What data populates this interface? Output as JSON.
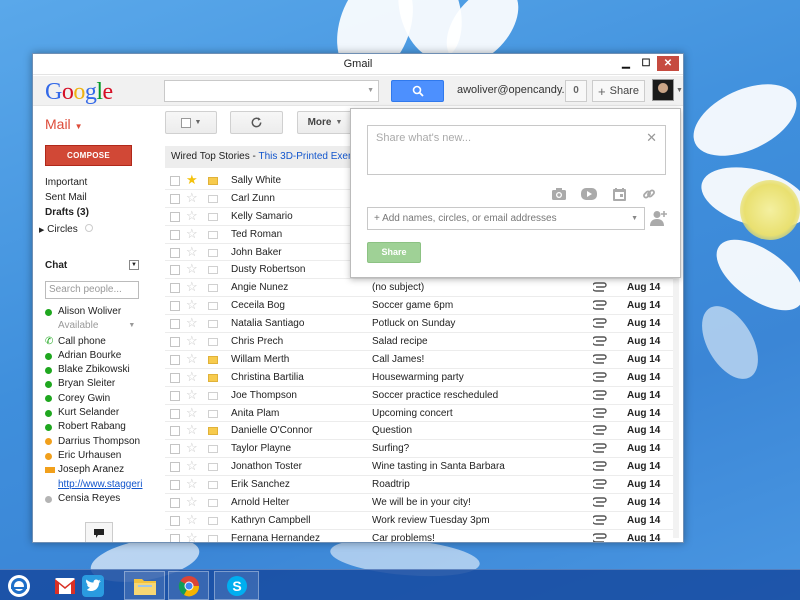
{
  "window": {
    "title": "Gmail"
  },
  "header": {
    "logo_letters": [
      {
        "ch": "G",
        "color": "#3369e8"
      },
      {
        "ch": "o",
        "color": "#d50f25"
      },
      {
        "ch": "o",
        "color": "#eeb211"
      },
      {
        "ch": "g",
        "color": "#3369e8"
      },
      {
        "ch": "l",
        "color": "#009925"
      },
      {
        "ch": "e",
        "color": "#d50f25"
      }
    ],
    "user_email": "awoliver@opencandy....",
    "notification_count": "0",
    "share_label": "Share"
  },
  "mail_label": "Mail",
  "toolbar": {
    "more_label": "More"
  },
  "compose_label": "COMPOSE",
  "nav": {
    "items": [
      {
        "label": "Important"
      },
      {
        "label": "Sent Mail"
      },
      {
        "label": "Drafts (3)"
      }
    ],
    "circles_label": "Circles"
  },
  "chat": {
    "title": "Chat",
    "search_placeholder": "Search people...",
    "self_name": "Alison Woliver",
    "self_status": "Available",
    "call_phone": "Call phone",
    "contacts": [
      {
        "name": "Adrian Bourke",
        "status": "green"
      },
      {
        "name": "Blake Zbikowski",
        "status": "green"
      },
      {
        "name": "Bryan Sleiter",
        "status": "green"
      },
      {
        "name": "Corey Gwin",
        "status": "green"
      },
      {
        "name": "Kurt Selander",
        "status": "green"
      },
      {
        "name": "Robert Rabang",
        "status": "green"
      },
      {
        "name": "Darrius Thompson",
        "status": "orange"
      },
      {
        "name": "Eric Urhausen",
        "status": "orange"
      }
    ],
    "video_contact": "Joseph Aranez",
    "video_link": "http://www.staggeri",
    "last_contact": "Censia Reyes"
  },
  "top_stories": {
    "source": "Wired Top Stories",
    "separator": " - ",
    "headline": "This 3D-Printed Exem"
  },
  "messages": [
    {
      "sender": "Sally White",
      "subject": "",
      "date": "",
      "starred": true,
      "label": true,
      "clip": false
    },
    {
      "sender": "Carl Zunn",
      "subject": "",
      "date": "",
      "starred": false,
      "label": false,
      "clip": false
    },
    {
      "sender": "Kelly Samario",
      "subject": "",
      "date": "",
      "starred": false,
      "label": false,
      "clip": false
    },
    {
      "sender": "Ted Roman",
      "subject": "",
      "date": "",
      "starred": false,
      "label": false,
      "clip": false
    },
    {
      "sender": "John Baker",
      "subject": "",
      "date": "",
      "starred": false,
      "label": false,
      "clip": false
    },
    {
      "sender": "Dusty Robertson",
      "subject": "",
      "date": "",
      "starred": false,
      "label": false,
      "clip": false
    },
    {
      "sender": "Angie Nunez",
      "subject": "(no subject)",
      "date": "Aug 14",
      "starred": false,
      "label": false,
      "clip": true
    },
    {
      "sender": "Ceceila Bog",
      "subject": "Soccer game 6pm",
      "date": "Aug 14",
      "starred": false,
      "label": false,
      "clip": true
    },
    {
      "sender": "Natalia Santiago",
      "subject": "Potluck on Sunday",
      "date": "Aug 14",
      "starred": false,
      "label": false,
      "clip": true
    },
    {
      "sender": "Chris Prech",
      "subject": "Salad recipe",
      "date": "Aug 14",
      "starred": false,
      "label": false,
      "clip": true
    },
    {
      "sender": "Willam Merth",
      "subject": "Call James!",
      "date": "Aug 14",
      "starred": false,
      "label": true,
      "clip": true
    },
    {
      "sender": "Christina Bartilia",
      "subject": "Housewarming party",
      "date": "Aug 14",
      "starred": false,
      "label": true,
      "clip": true
    },
    {
      "sender": "Joe Thompson",
      "subject": "Soccer practice rescheduled",
      "date": "Aug 14",
      "starred": false,
      "label": false,
      "clip": true
    },
    {
      "sender": "Anita Plam",
      "subject": "Upcoming concert",
      "date": "Aug 14",
      "starred": false,
      "label": false,
      "clip": true
    },
    {
      "sender": "Danielle O'Connor",
      "subject": "Question",
      "date": "Aug 14",
      "starred": false,
      "label": true,
      "clip": true
    },
    {
      "sender": "Taylor Playne",
      "subject": "Surfing?",
      "date": "Aug 14",
      "starred": false,
      "label": false,
      "clip": true
    },
    {
      "sender": "Jonathon Toster",
      "subject": "Wine tasting in Santa Barbara",
      "date": "Aug 14",
      "starred": false,
      "label": false,
      "clip": true
    },
    {
      "sender": "Erik Sanchez",
      "subject": "Roadtrip",
      "date": "Aug 14",
      "starred": false,
      "label": false,
      "clip": true
    },
    {
      "sender": "Arnold Helter",
      "subject": "We will be in your city!",
      "date": "Aug 14",
      "starred": false,
      "label": false,
      "clip": true
    },
    {
      "sender": "Kathryn Campbell",
      "subject": "Work review Tuesday 3pm",
      "date": "Aug 14",
      "starred": false,
      "label": false,
      "clip": true
    },
    {
      "sender": "Fernana Hernandez",
      "subject": "Car problems!",
      "date": "Aug 14",
      "starred": false,
      "label": false,
      "clip": true
    }
  ],
  "share_popup": {
    "placeholder": "Share what's new...",
    "names_placeholder": "+ Add names, circles, or email addresses",
    "share_button": "Share"
  },
  "colors": {
    "accent_blue": "#4d90fe",
    "compose_red": "#d14836",
    "mail_red": "#dd4b39",
    "star": "#f4c20d"
  },
  "taskbar": {
    "items": [
      "ie-icon",
      "gmail-icon",
      "twitter-icon",
      "file-explorer-icon",
      "chrome-icon",
      "skype-icon"
    ]
  }
}
